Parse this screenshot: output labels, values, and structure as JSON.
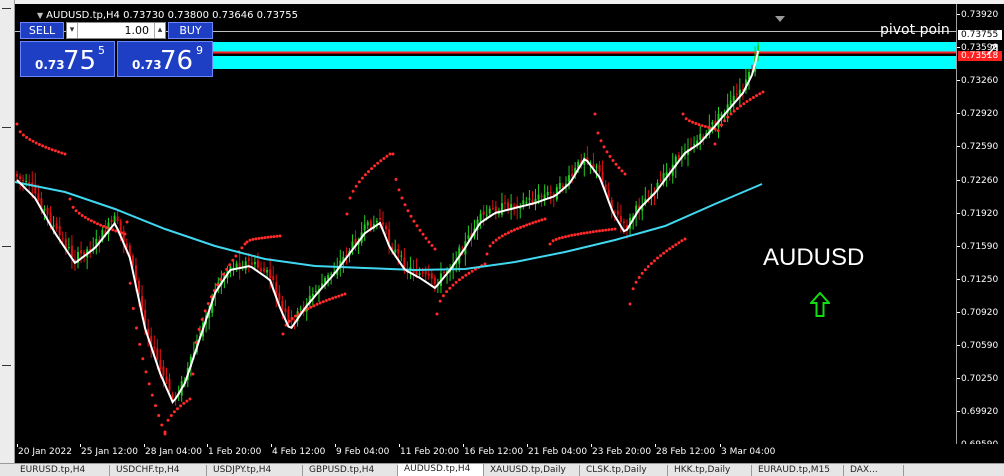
{
  "symbol_header": {
    "text": "AUDUSD.tp,H4  0.73730 0.73800 0.73646 0.73755"
  },
  "trade_panel": {
    "sell_label": "SELL",
    "buy_label": "BUY",
    "volume": "1.00",
    "sell_price": {
      "prefix": "0.73",
      "big": "75",
      "sup": "5"
    },
    "buy_price": {
      "prefix": "0.73",
      "big": "76",
      "sup": "9"
    }
  },
  "chart_overlay": {
    "pivot_label": "pivot poin",
    "symbol_watermark": "AUDUSD",
    "colors": {
      "candle_up": "#22cc22",
      "candle_down": "#dd1111",
      "sar": "#ff2a2a",
      "ma_fast": "#ffffff",
      "ma_slow": "#40d8f0",
      "pivot_zone": "#00ffff",
      "pivot_line": "#ff2020",
      "arrow": "#11dd11"
    },
    "icons": {
      "arrow": "up-arrow-outline-icon"
    }
  },
  "price_scale": {
    "labels": [
      "0.73920",
      "0.73590",
      "0.73260",
      "0.72920",
      "0.72590",
      "0.72260",
      "0.71920",
      "0.71590",
      "0.71250",
      "0.70920",
      "0.70590",
      "0.70250",
      "0.69920",
      "0.69590"
    ],
    "current_price": "0.73755",
    "red_level": "0.73518"
  },
  "time_scale": {
    "labels": [
      "20 Jan 2022",
      "25 Jan 12:00",
      "28 Jan 04:00",
      "1 Feb 20:00",
      "4 Feb 12:00",
      "9 Feb 04:00",
      "11 Feb 20:00",
      "16 Feb 12:00",
      "21 Feb 04:00",
      "23 Feb 20:00",
      "28 Feb 12:00",
      "3 Mar 04:00"
    ]
  },
  "tabs": [
    {
      "label": "EURUSD.tp,H4",
      "active": false
    },
    {
      "label": "USDCHF.tp,H4",
      "active": false
    },
    {
      "label": "USDJPY.tp,H4",
      "active": false
    },
    {
      "label": "GBPUSD.tp,H4",
      "active": false
    },
    {
      "label": "AUDUSD.tp,H4",
      "active": true
    },
    {
      "label": "XAUUSD.tp,Daily",
      "active": false
    },
    {
      "label": "CLSK.tp,Daily",
      "active": false
    },
    {
      "label": "HKK.tp,Daily",
      "active": false
    },
    {
      "label": "EURAUD.tp,M15",
      "active": false
    },
    {
      "label": "DAX...",
      "active": false
    }
  ]
}
